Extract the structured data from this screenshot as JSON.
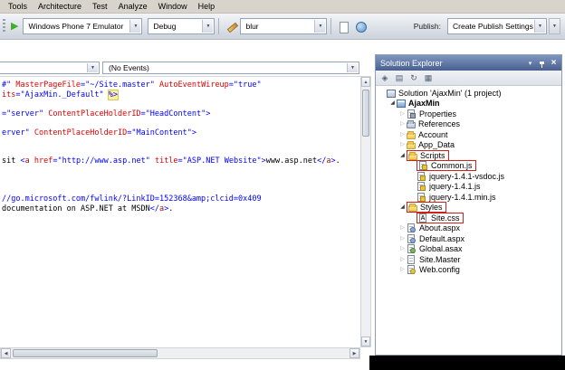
{
  "menubar": {
    "items": [
      "Tools",
      "Architecture",
      "Test",
      "Analyze",
      "Window",
      "Help"
    ]
  },
  "toolbar": {
    "device": "Windows Phone 7 Emulator",
    "config": "Debug",
    "search": "blur",
    "publish_label": "Publish:",
    "publish_value": "Create Publish Settings"
  },
  "editor": {
    "left_dropdown": "",
    "events_dropdown": "(No Events)",
    "code_lines": [
      [
        {
          "t": "#\" ",
          "c": "val"
        },
        {
          "t": "MasterPageFile",
          "c": "attr"
        },
        {
          "t": "=",
          "c": "delim"
        },
        {
          "t": "\"~/Site.master\"",
          "c": "val"
        },
        {
          "t": " ",
          "c": "plain"
        },
        {
          "t": "AutoEventWireup",
          "c": "attr"
        },
        {
          "t": "=",
          "c": "delim"
        },
        {
          "t": "\"true\"",
          "c": "val"
        }
      ],
      [
        {
          "t": "its",
          "c": "attr"
        },
        {
          "t": "=",
          "c": "delim"
        },
        {
          "t": "\"AjaxMin._Default\"",
          "c": "val"
        },
        {
          "t": " ",
          "c": "plain"
        },
        {
          "t": "%>",
          "c": "asp"
        }
      ],
      [],
      [
        {
          "t": "=",
          "c": "delim"
        },
        {
          "t": "\"server\"",
          "c": "val"
        },
        {
          "t": " ",
          "c": "plain"
        },
        {
          "t": "ContentPlaceHolderID",
          "c": "attr"
        },
        {
          "t": "=",
          "c": "delim"
        },
        {
          "t": "\"HeadContent\"",
          "c": "val"
        },
        {
          "t": ">",
          "c": "delim"
        }
      ],
      [],
      [
        {
          "t": "erver\"",
          "c": "val"
        },
        {
          "t": " ",
          "c": "plain"
        },
        {
          "t": "ContentPlaceHolderID",
          "c": "attr"
        },
        {
          "t": "=",
          "c": "delim"
        },
        {
          "t": "\"MainContent\"",
          "c": "val"
        },
        {
          "t": ">",
          "c": "delim"
        }
      ],
      [],
      [],
      [
        {
          "t": "sit ",
          "c": "plain"
        },
        {
          "t": "<",
          "c": "delim"
        },
        {
          "t": "a",
          "c": "tag"
        },
        {
          "t": " ",
          "c": "plain"
        },
        {
          "t": "href",
          "c": "attr"
        },
        {
          "t": "=",
          "c": "delim"
        },
        {
          "t": "\"http://www.asp.net\"",
          "c": "val"
        },
        {
          "t": " ",
          "c": "plain"
        },
        {
          "t": "title",
          "c": "attr"
        },
        {
          "t": "=",
          "c": "delim"
        },
        {
          "t": "\"ASP.NET Website\"",
          "c": "val"
        },
        {
          "t": ">",
          "c": "delim"
        },
        {
          "t": "www.asp.net",
          "c": "plain"
        },
        {
          "t": "</",
          "c": "delim"
        },
        {
          "t": "a",
          "c": "tag"
        },
        {
          "t": ">",
          "c": "delim"
        },
        {
          "t": ".",
          "c": "plain"
        }
      ],
      [],
      [],
      [],
      [
        {
          "t": "//go.microsoft.com/fwlink/?LinkID=152368&amp;clcid=0x409",
          "c": "val"
        }
      ],
      [
        {
          "t": "documentation on ASP.NET at MSDN",
          "c": "plain"
        },
        {
          "t": "</",
          "c": "delim"
        },
        {
          "t": "a",
          "c": "tag"
        },
        {
          "t": ">",
          "c": "delim"
        },
        {
          "t": ".",
          "c": "plain"
        }
      ]
    ]
  },
  "solution_explorer": {
    "title": "Solution Explorer",
    "tree": [
      {
        "label": "Solution 'AjaxMin' (1 project)",
        "indent": 0,
        "icon": "solution",
        "arrow": "none"
      },
      {
        "label": "AjaxMin",
        "indent": 1,
        "icon": "project",
        "arrow": "expanded",
        "bold": true
      },
      {
        "label": "Properties",
        "indent": 2,
        "icon": "properties",
        "arrow": "collapsed"
      },
      {
        "label": "References",
        "indent": 2,
        "icon": "references-folder",
        "arrow": "collapsed"
      },
      {
        "label": "Account",
        "indent": 2,
        "icon": "folder",
        "arrow": "collapsed"
      },
      {
        "label": "App_Data",
        "indent": 2,
        "icon": "folder",
        "arrow": "collapsed"
      },
      {
        "label": "Scripts",
        "indent": 2,
        "icon": "folder",
        "arrow": "expanded",
        "highlight": true
      },
      {
        "label": "Common.js",
        "indent": 3,
        "icon": "js",
        "arrow": "none",
        "highlight": true
      },
      {
        "label": "jquery-1.4.1-vsdoc.js",
        "indent": 3,
        "icon": "js",
        "arrow": "none"
      },
      {
        "label": "jquery-1.4.1.js",
        "indent": 3,
        "icon": "js",
        "arrow": "none"
      },
      {
        "label": "jquery-1.4.1.min.js",
        "indent": 3,
        "icon": "js",
        "arrow": "none"
      },
      {
        "label": "Styles",
        "indent": 2,
        "icon": "folder",
        "arrow": "expanded",
        "highlight": true
      },
      {
        "label": "Site.css",
        "indent": 3,
        "icon": "css",
        "arrow": "none",
        "highlight": true
      },
      {
        "label": "About.aspx",
        "indent": 2,
        "icon": "aspx",
        "arrow": "collapsed"
      },
      {
        "label": "Default.aspx",
        "indent": 2,
        "icon": "aspx",
        "arrow": "collapsed"
      },
      {
        "label": "Global.asax",
        "indent": 2,
        "icon": "asax",
        "arrow": "collapsed"
      },
      {
        "label": "Site.Master",
        "indent": 2,
        "icon": "page",
        "arrow": "collapsed"
      },
      {
        "label": "Web.config",
        "indent": 2,
        "icon": "config",
        "arrow": "collapsed"
      }
    ]
  },
  "colors": {
    "plain": "#000000",
    "attr": "#e00000",
    "val": "#0000ff",
    "tag": "#a31515",
    "aspbg": "#fdeea0",
    "hl": "#cc2218",
    "seTitleFrom": "#7e97bf",
    "seTitleTo": "#49608f"
  }
}
